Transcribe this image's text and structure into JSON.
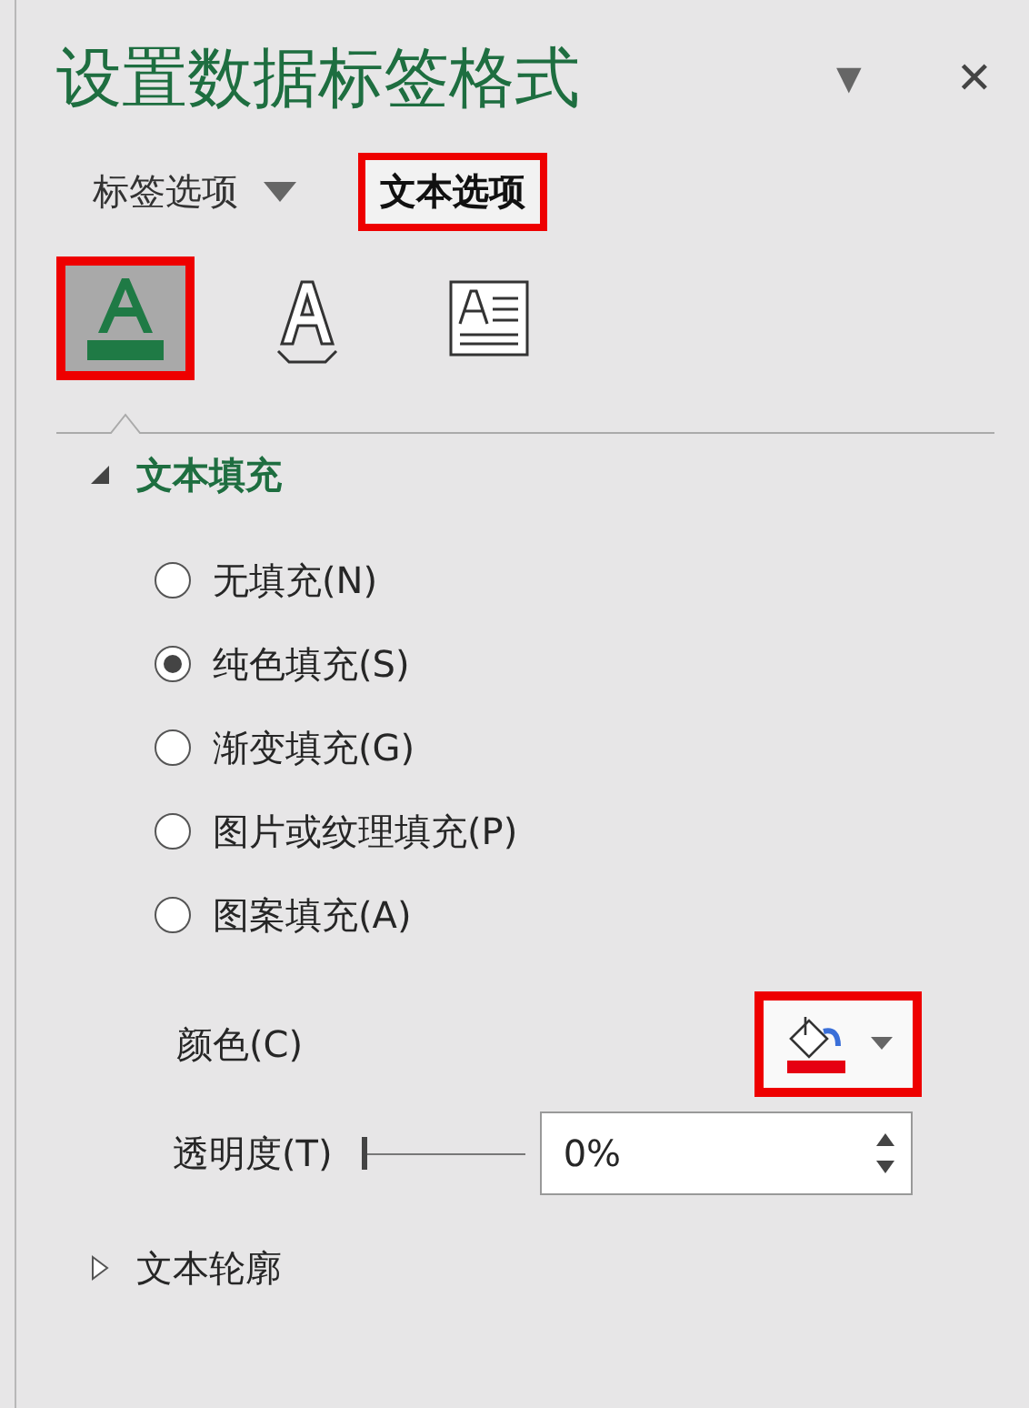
{
  "panel": {
    "title": "设置数据标签格式",
    "menu_arrow": "▼",
    "close": "✕"
  },
  "tabs": [
    {
      "label": "标签选项",
      "selected": false,
      "highlighted": false,
      "has_dropdown": true
    },
    {
      "label": "文本选项",
      "selected": true,
      "highlighted": true,
      "has_dropdown": false
    }
  ],
  "icon_tabs": [
    {
      "kind": "fill",
      "selected": true,
      "highlighted": true
    },
    {
      "kind": "outline",
      "selected": false,
      "highlighted": false
    },
    {
      "kind": "textbox",
      "selected": false,
      "highlighted": false
    }
  ],
  "sections": [
    {
      "title": "文本填充",
      "expanded": true,
      "options": [
        {
          "label": "无填充(N)",
          "selected": false
        },
        {
          "label": "纯色填充(S)",
          "selected": true
        },
        {
          "label": "渐变填充(G)",
          "selected": false
        },
        {
          "label": "图片或纹理填充(P)",
          "selected": false
        },
        {
          "label": "图案填充(A)",
          "selected": false
        }
      ],
      "color": {
        "label": "颜色(C)",
        "color": "#e60012",
        "highlighted": true
      },
      "transparency": {
        "label": "透明度(T)",
        "level": 0,
        "value": "0%"
      }
    },
    {
      "title": "文本轮廓",
      "expanded": false
    }
  ]
}
